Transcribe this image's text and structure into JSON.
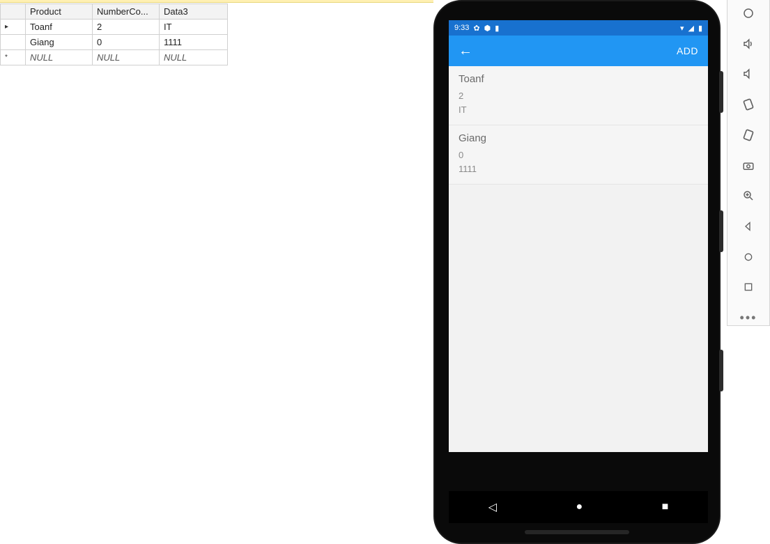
{
  "db_table": {
    "columns": [
      "Product",
      "NumberCo...",
      "Data3"
    ],
    "rows": [
      {
        "marker": "▸",
        "product": "Toanf",
        "number": "2",
        "data3": "IT",
        "is_null": false
      },
      {
        "marker": "",
        "product": "Giang",
        "number": "0",
        "data3": "1111",
        "is_null": false
      },
      {
        "marker": "*",
        "product": "NULL",
        "number": "NULL",
        "data3": "NULL",
        "is_null": true
      }
    ]
  },
  "phone": {
    "status": {
      "time": "9:33",
      "icons_left": [
        "gear-icon",
        "shield-icon",
        "battery-small-icon"
      ],
      "icons_right": [
        "wifi-icon",
        "signal-icon",
        "battery-icon"
      ]
    },
    "appbar": {
      "back_icon": "arrow-back",
      "add_label": "ADD"
    },
    "items": [
      {
        "title": "Toanf",
        "line1": "2",
        "line2": "IT"
      },
      {
        "title": "Giang",
        "line1": "0",
        "line2": "1111"
      }
    ],
    "nav": {
      "back": "◁",
      "home": "●",
      "recent": "■"
    }
  },
  "emu_toolbar": {
    "buttons": [
      "power-icon",
      "volume-up-icon",
      "volume-down-icon",
      "rotate-left-icon",
      "rotate-right-icon",
      "camera-icon",
      "zoom-in-icon",
      "back-icon",
      "home-icon",
      "overview-icon",
      "more-icon"
    ]
  }
}
